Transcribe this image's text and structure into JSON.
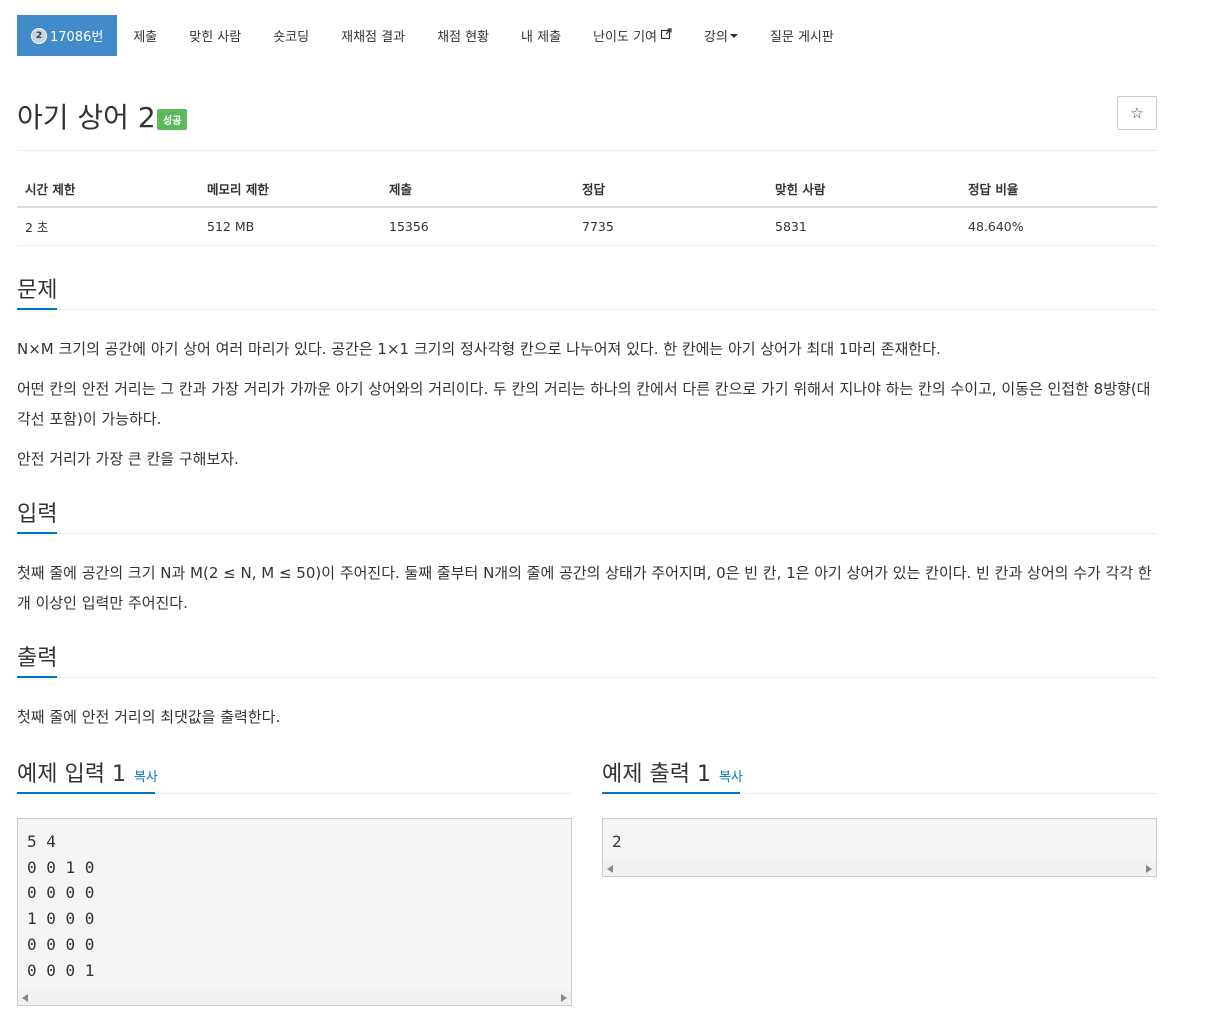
{
  "nav": {
    "problem_number": "17086번",
    "tier_glyph": "2",
    "items": [
      "제출",
      "맞힌 사람",
      "숏코딩",
      "재채점 결과",
      "채점 현황",
      "내 제출",
      "난이도 기여",
      "강의",
      "질문 게시판"
    ]
  },
  "title": {
    "text": "아기 상어 2",
    "badge": "성공",
    "star_icon": "☆"
  },
  "info_table": {
    "headers": [
      "시간 제한",
      "메모리 제한",
      "제출",
      "정답",
      "맞힌 사람",
      "정답 비율"
    ],
    "values": [
      "2 초",
      "512 MB",
      "15356",
      "7735",
      "5831",
      "48.640%"
    ]
  },
  "sections": {
    "problem": {
      "heading": "문제",
      "paragraphs": [
        "N×M 크기의 공간에 아기 상어 여러 마리가 있다. 공간은 1×1 크기의 정사각형 칸으로 나누어져 있다. 한 칸에는 아기 상어가 최대 1마리 존재한다.",
        "어떤 칸의 안전 거리는 그 칸과 가장 거리가 가까운 아기 상어와의 거리이다. 두 칸의 거리는 하나의 칸에서 다른 칸으로 가기 위해서 지나야 하는 칸의 수이고, 이동은 인접한 8방향(대각선 포함)이 가능하다.",
        "안전 거리가 가장 큰 칸을 구해보자."
      ]
    },
    "input": {
      "heading": "입력",
      "paragraph": "첫째 줄에 공간의 크기 N과 M(2 ≤ N, M ≤ 50)이 주어진다. 둘째 줄부터 N개의 줄에 공간의 상태가 주어지며, 0은 빈 칸, 1은 아기 상어가 있는 칸이다. 빈 칸과 상어의 수가 각각 한 개 이상인 입력만 주어진다."
    },
    "output": {
      "heading": "출력",
      "paragraph": "첫째 줄에 안전 거리의 최댓값을 출력한다."
    }
  },
  "samples": {
    "input_heading": "예제 입력 1",
    "output_heading": "예제 출력 1",
    "copy_label": "복사",
    "input_text": "5 4\n0 0 1 0\n0 0 0 0\n1 0 0 0\n0 0 0 0\n0 0 0 1",
    "output_text": "2"
  },
  "colors": {
    "active_tab": "#428bca",
    "success_badge": "#5cb85c",
    "accent": "#0076c0"
  }
}
